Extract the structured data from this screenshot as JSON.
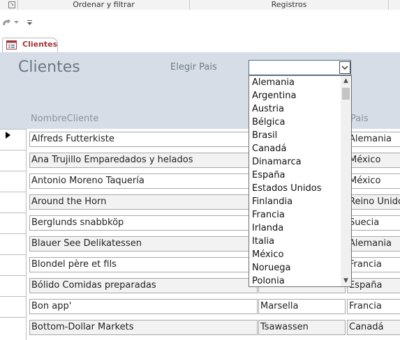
{
  "ribbon": {
    "groups": [
      "Ordenar y filtrar",
      "Registros"
    ]
  },
  "qat": {
    "redo_icon": "redo-icon",
    "dropdown_icon": "chevron-down-icon",
    "customize_icon": "customize-qat-icon"
  },
  "tab": {
    "label": "Clientes",
    "icon": "form-icon"
  },
  "form": {
    "title": "Clientes",
    "pais_label": "Elegir Pais",
    "pais_value": "",
    "col_nombre": "NombreCliente",
    "col_pais": "Pais"
  },
  "rows": [
    {
      "nombre": "Alfreds Futterkiste",
      "ciudad": "",
      "pais": "Alemania"
    },
    {
      "nombre": "Ana Trujillo Emparedados y helados",
      "ciudad": "",
      "pais": "México"
    },
    {
      "nombre": "Antonio Moreno Taquería",
      "ciudad": "",
      "pais": "México"
    },
    {
      "nombre": "Around the Horn",
      "ciudad": "",
      "pais": "Reino Unido"
    },
    {
      "nombre": "Berglunds snabbköp",
      "ciudad": "",
      "pais": "Suecia"
    },
    {
      "nombre": "Blauer See Delikatessen",
      "ciudad": "",
      "pais": "Alemania"
    },
    {
      "nombre": "Blondel père et fils",
      "ciudad": "",
      "pais": "Francia"
    },
    {
      "nombre": "Bólido Comidas preparadas",
      "ciudad": "",
      "pais": "España"
    },
    {
      "nombre": "Bon app'",
      "ciudad": "Marsella",
      "pais": "Francia"
    },
    {
      "nombre": "Bottom-Dollar Markets",
      "ciudad": "Tsawassen",
      "pais": "Canadá"
    }
  ],
  "dropdown": {
    "options": [
      "Alemania",
      "Argentina",
      "Austria",
      "Bélgica",
      "Brasil",
      "Canadá",
      "Dinamarca",
      "España",
      "Estados Unidos",
      "Finlandia",
      "Francia",
      "Irlanda",
      "Italia",
      "México",
      "Noruega",
      "Polonia"
    ],
    "scroll_up_icon": "scroll-up-icon",
    "scroll_down_icon": "scroll-down-icon"
  },
  "colors": {
    "header_bg": "#d6dde6",
    "tab_text": "#a4373a",
    "title_text": "#6b7886"
  }
}
